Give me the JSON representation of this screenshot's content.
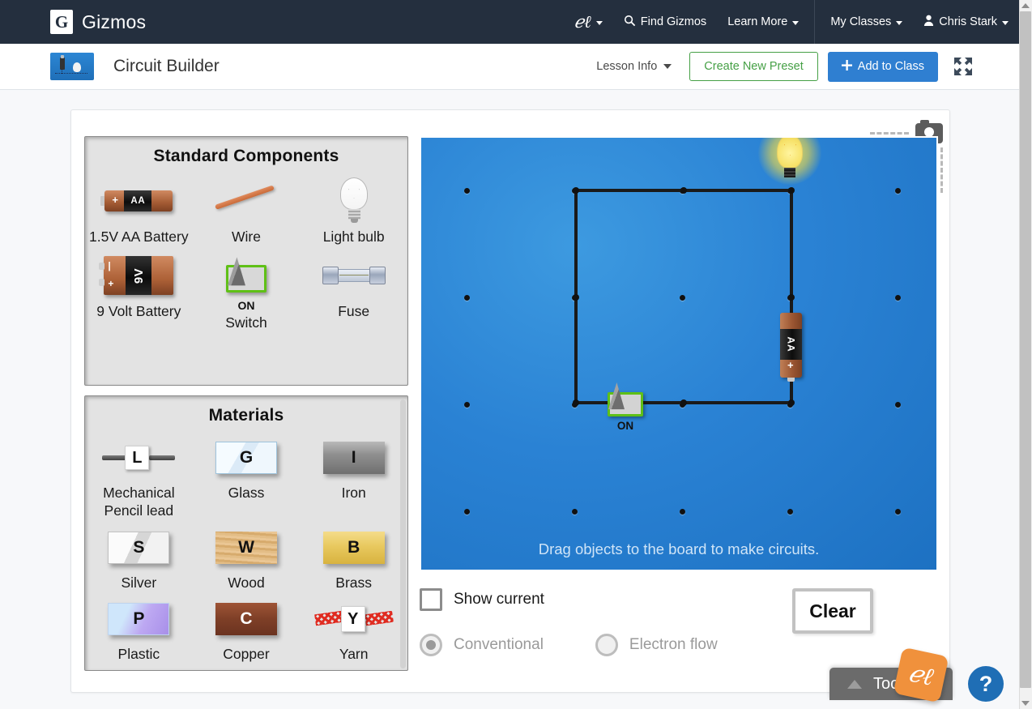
{
  "navbar": {
    "brand_mark": "G",
    "brand_name": "Gizmos",
    "el_logo_icon": "el-script-logo-icon",
    "items": [
      {
        "label": "",
        "icon": "el-script-logo-icon",
        "caret": true
      },
      {
        "label": "Find Gizmos",
        "icon": "search-icon",
        "caret": false
      },
      {
        "label": "Learn More",
        "icon": "",
        "caret": true
      },
      {
        "label": "My Classes",
        "icon": "",
        "caret": true
      },
      {
        "label": "Chris Stark",
        "icon": "person-icon",
        "caret": true
      }
    ]
  },
  "subheader": {
    "thumbnail_icon": "circuit-builder-thumbnail",
    "title": "Circuit Builder",
    "lesson_info": "Lesson Info",
    "create_preset": "Create New Preset",
    "add_to_class": "Add to Class",
    "add_to_class_icon": "plus-icon",
    "expand_icon": "fullscreen-expand-icon"
  },
  "standard_components": {
    "title": "Standard Components",
    "items": [
      {
        "label": "1.5V AA Battery",
        "icon": "aa-battery-icon",
        "badge": "AA",
        "polarity": "+"
      },
      {
        "label": "Wire",
        "icon": "wire-icon"
      },
      {
        "label": "Light bulb",
        "icon": "light-bulb-icon"
      },
      {
        "label": "9 Volt Battery",
        "icon": "9v-battery-icon",
        "badge": "9V"
      },
      {
        "label": "Switch",
        "icon": "switch-icon",
        "state": "ON"
      },
      {
        "label": "Fuse",
        "icon": "fuse-icon"
      }
    ]
  },
  "materials": {
    "title": "Materials",
    "items": [
      {
        "label": "Mechanical Pencil lead",
        "badge": "L",
        "icon": "pencil-lead-icon"
      },
      {
        "label": "Glass",
        "badge": "G",
        "icon": "glass-block-icon"
      },
      {
        "label": "Iron",
        "badge": "I",
        "icon": "iron-block-icon"
      },
      {
        "label": "Silver",
        "badge": "S",
        "icon": "silver-block-icon"
      },
      {
        "label": "Wood",
        "badge": "W",
        "icon": "wood-block-icon"
      },
      {
        "label": "Brass",
        "badge": "B",
        "icon": "brass-block-icon"
      },
      {
        "label": "Plastic",
        "badge": "P",
        "icon": "plastic-block-icon"
      },
      {
        "label": "Copper",
        "badge": "C",
        "icon": "copper-block-icon"
      },
      {
        "label": "Yarn",
        "badge": "Y",
        "icon": "yarn-icon"
      }
    ]
  },
  "board": {
    "hint": "Drag objects to the board to make circuits.",
    "camera_icon": "camera-snapshot-icon",
    "background_color": "#2a82d4",
    "grid_cols": 5,
    "grid_rows": 4,
    "placed": {
      "light_bulb": {
        "state": "lit",
        "glow_color": "#ffe14a"
      },
      "aa_battery": {
        "badge": "AA",
        "polarity": "+"
      },
      "switch": {
        "state": "ON",
        "label": "ON"
      }
    }
  },
  "controls": {
    "show_current_label": "Show current",
    "show_current_checked": false,
    "flow_selected": "Conventional",
    "flow_options": [
      "Conventional",
      "Electron flow"
    ],
    "clear_label": "Clear",
    "tools_label": "Tools",
    "tools_icon": "triangle-up-icon",
    "el_badge_icon": "el-script-logo-icon",
    "help_label": "?"
  }
}
